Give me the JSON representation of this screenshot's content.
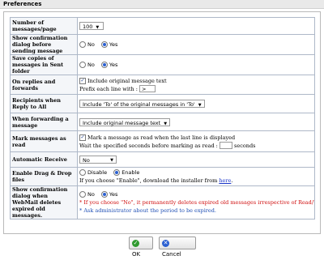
{
  "window": {
    "title": "Preferences"
  },
  "rows": {
    "messages_per_page": {
      "label": "Number of messages/page",
      "value": "100"
    },
    "confirm_send": {
      "label": "Show confirmation dialog before sending message",
      "no": "No",
      "yes": "Yes",
      "selected": "yes"
    },
    "save_copies": {
      "label": "Save copies of messages in Sent folder",
      "no": "No",
      "yes": "Yes",
      "selected": "yes"
    },
    "replies_forwards": {
      "label": "On replies and forwards",
      "include_text": "Include original message text",
      "prefix_label": "Prefix each line with :",
      "prefix_value": ">"
    },
    "reply_all": {
      "label": "Recipients when Reply to All",
      "value": "Include 'To' of the original messages in 'To'"
    },
    "forwarding": {
      "label": "When forwarding a message",
      "value": "Include original message text"
    },
    "mark_read": {
      "label": "Mark messages as read",
      "checkbox_text": "Mark a message as read when the last line is displayed",
      "wait_text": "Wait the specified seconds before marking as read :",
      "wait_value": "",
      "seconds": "seconds"
    },
    "auto_receive": {
      "label": "Automatic Receive",
      "value": "No"
    },
    "drag_drop": {
      "label": "Enable Drag & Drop files",
      "disable": "Disable",
      "enable": "Enable",
      "selected": "enable",
      "note_prefix": "If you choose \"Enable\", download the installer from",
      "link": "here",
      "note_suffix": "."
    },
    "expired_confirm": {
      "label": "Show confirmation dialog when WebMail deletes expired old messages.",
      "no": "No",
      "yes": "Yes",
      "selected": "yes",
      "warning": "* If you choose \"No\", it permanently deletes expired old messages irrespective of Read/Unread.",
      "info": "* Ask administrator about the period to be expired."
    }
  },
  "buttons": {
    "ok": "OK",
    "cancel": "Cancel"
  },
  "icons": {
    "ok": "check-icon",
    "cancel": "cancel-icon"
  },
  "colors": {
    "ok_icon": "#2f9a2f",
    "cancel_icon": "#2a5fd1",
    "warning": "#d01010",
    "info": "#1f4fb5"
  }
}
